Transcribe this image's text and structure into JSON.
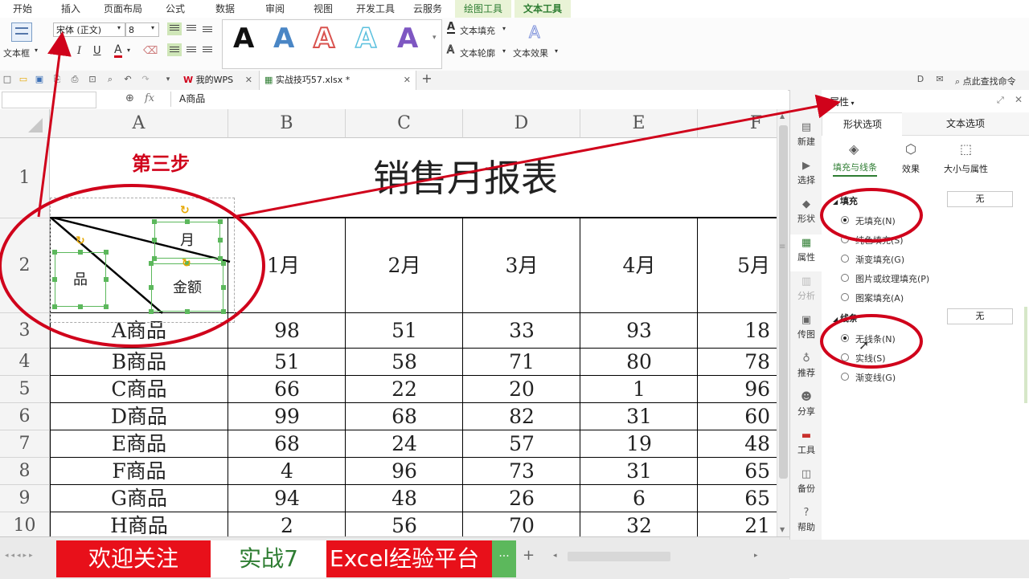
{
  "menu": {
    "tabs": [
      "开始",
      "插入",
      "页面布局",
      "公式",
      "数据",
      "审阅",
      "视图",
      "开发工具",
      "云服务",
      "绘图工具",
      "文本工具"
    ]
  },
  "ribbon": {
    "textbox_label": "文本框",
    "font_name": "宋体 (正文)",
    "font_size": "8",
    "fmt_bold": "B",
    "fmt_italic": "I",
    "fmt_underline": "U",
    "fmt_color": "A",
    "art_letter": "A",
    "text_fill": "文本填充",
    "text_outline": "文本轮廓",
    "text_effect": "文本效果"
  },
  "quickbar": {
    "tab_wps": "我的WPS",
    "tab_file": "实战技巧57.xlsx *",
    "add": "+",
    "search": "点此查找命令"
  },
  "formula": {
    "fx": "fx",
    "content": "A商品"
  },
  "sheet": {
    "columns": [
      "A",
      "B",
      "C",
      "D",
      "E",
      "F"
    ],
    "rows": [
      "1",
      "2",
      "3",
      "4",
      "5",
      "6",
      "7",
      "8",
      "9",
      "10"
    ],
    "title": "销售月报表",
    "step_label": "第三步",
    "diag_month": "月",
    "diag_product": "品",
    "diag_amount": "金额",
    "months": [
      "1月",
      "2月",
      "3月",
      "4月",
      "5月"
    ],
    "data": [
      {
        "name": "A商品",
        "v": [
          "98",
          "51",
          "33",
          "93",
          "18"
        ]
      },
      {
        "name": "B商品",
        "v": [
          "51",
          "58",
          "71",
          "80",
          "78"
        ]
      },
      {
        "name": "C商品",
        "v": [
          "66",
          "22",
          "20",
          "1",
          "96"
        ]
      },
      {
        "name": "D商品",
        "v": [
          "99",
          "68",
          "82",
          "31",
          "60"
        ]
      },
      {
        "name": "E商品",
        "v": [
          "68",
          "24",
          "57",
          "19",
          "48"
        ]
      },
      {
        "name": "F商品",
        "v": [
          "4",
          "96",
          "73",
          "31",
          "65"
        ]
      },
      {
        "name": "G商品",
        "v": [
          "94",
          "48",
          "26",
          "6",
          "65"
        ]
      },
      {
        "name": "H商品",
        "v": [
          "2",
          "56",
          "70",
          "32",
          "21"
        ]
      }
    ]
  },
  "side": {
    "items": [
      "新建",
      "选择",
      "形状",
      "属性",
      "分析",
      "传图",
      "推荐",
      "分享",
      "工具",
      "备份",
      "帮助"
    ]
  },
  "panel": {
    "title": "属性",
    "tab_shape": "形状选项",
    "tab_text": "文本选项",
    "sub_fill_line": "填充与线条",
    "sub_effect": "效果",
    "sub_size": "大小与属性",
    "fill_header": "填充",
    "fill_value": "无",
    "fill_options": [
      "无填充(N)",
      "纯色填充(S)",
      "渐变填充(G)",
      "图片或纹理填充(P)",
      "图案填充(A)"
    ],
    "line_header": "线条",
    "line_value": "无",
    "line_options": [
      "无线条(N)",
      "实线(S)",
      "渐变线(G)"
    ]
  },
  "sheetbar": {
    "tab1": "欢迎关注",
    "tab2": "实战7",
    "tab3": "Excel经验平台",
    "more": "···",
    "add": "+"
  },
  "colors": {
    "accent_green": "#2e7d32",
    "annotation_red": "#d0021b",
    "sheet_tab_red": "#e8101a",
    "handle_green": "#5cb85c"
  }
}
